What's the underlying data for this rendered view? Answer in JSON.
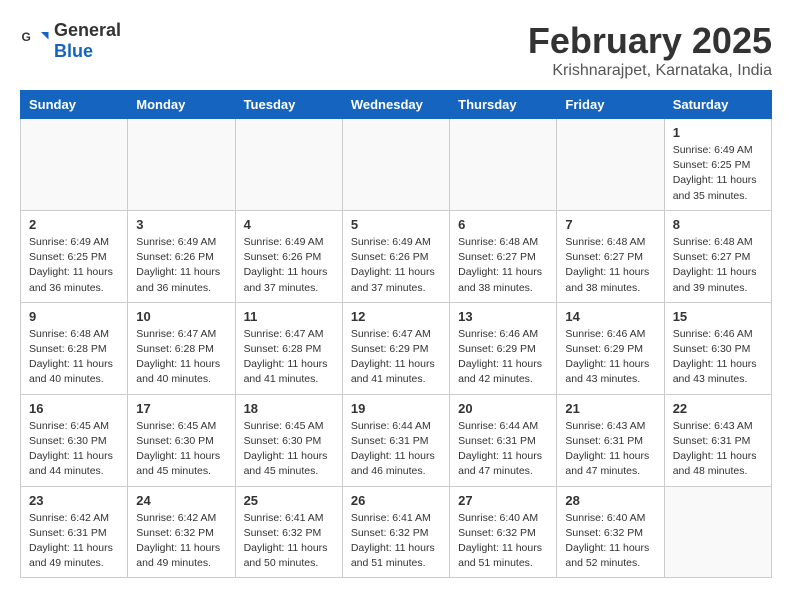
{
  "header": {
    "logo_general": "General",
    "logo_blue": "Blue",
    "title": "February 2025",
    "subtitle": "Krishnarajpet, Karnataka, India"
  },
  "days_of_week": [
    "Sunday",
    "Monday",
    "Tuesday",
    "Wednesday",
    "Thursday",
    "Friday",
    "Saturday"
  ],
  "weeks": [
    [
      {
        "day": "",
        "info": ""
      },
      {
        "day": "",
        "info": ""
      },
      {
        "day": "",
        "info": ""
      },
      {
        "day": "",
        "info": ""
      },
      {
        "day": "",
        "info": ""
      },
      {
        "day": "",
        "info": ""
      },
      {
        "day": "1",
        "info": "Sunrise: 6:49 AM\nSunset: 6:25 PM\nDaylight: 11 hours\nand 35 minutes."
      }
    ],
    [
      {
        "day": "2",
        "info": "Sunrise: 6:49 AM\nSunset: 6:25 PM\nDaylight: 11 hours\nand 36 minutes."
      },
      {
        "day": "3",
        "info": "Sunrise: 6:49 AM\nSunset: 6:26 PM\nDaylight: 11 hours\nand 36 minutes."
      },
      {
        "day": "4",
        "info": "Sunrise: 6:49 AM\nSunset: 6:26 PM\nDaylight: 11 hours\nand 37 minutes."
      },
      {
        "day": "5",
        "info": "Sunrise: 6:49 AM\nSunset: 6:26 PM\nDaylight: 11 hours\nand 37 minutes."
      },
      {
        "day": "6",
        "info": "Sunrise: 6:48 AM\nSunset: 6:27 PM\nDaylight: 11 hours\nand 38 minutes."
      },
      {
        "day": "7",
        "info": "Sunrise: 6:48 AM\nSunset: 6:27 PM\nDaylight: 11 hours\nand 38 minutes."
      },
      {
        "day": "8",
        "info": "Sunrise: 6:48 AM\nSunset: 6:27 PM\nDaylight: 11 hours\nand 39 minutes."
      }
    ],
    [
      {
        "day": "9",
        "info": "Sunrise: 6:48 AM\nSunset: 6:28 PM\nDaylight: 11 hours\nand 40 minutes."
      },
      {
        "day": "10",
        "info": "Sunrise: 6:47 AM\nSunset: 6:28 PM\nDaylight: 11 hours\nand 40 minutes."
      },
      {
        "day": "11",
        "info": "Sunrise: 6:47 AM\nSunset: 6:28 PM\nDaylight: 11 hours\nand 41 minutes."
      },
      {
        "day": "12",
        "info": "Sunrise: 6:47 AM\nSunset: 6:29 PM\nDaylight: 11 hours\nand 41 minutes."
      },
      {
        "day": "13",
        "info": "Sunrise: 6:46 AM\nSunset: 6:29 PM\nDaylight: 11 hours\nand 42 minutes."
      },
      {
        "day": "14",
        "info": "Sunrise: 6:46 AM\nSunset: 6:29 PM\nDaylight: 11 hours\nand 43 minutes."
      },
      {
        "day": "15",
        "info": "Sunrise: 6:46 AM\nSunset: 6:30 PM\nDaylight: 11 hours\nand 43 minutes."
      }
    ],
    [
      {
        "day": "16",
        "info": "Sunrise: 6:45 AM\nSunset: 6:30 PM\nDaylight: 11 hours\nand 44 minutes."
      },
      {
        "day": "17",
        "info": "Sunrise: 6:45 AM\nSunset: 6:30 PM\nDaylight: 11 hours\nand 45 minutes."
      },
      {
        "day": "18",
        "info": "Sunrise: 6:45 AM\nSunset: 6:30 PM\nDaylight: 11 hours\nand 45 minutes."
      },
      {
        "day": "19",
        "info": "Sunrise: 6:44 AM\nSunset: 6:31 PM\nDaylight: 11 hours\nand 46 minutes."
      },
      {
        "day": "20",
        "info": "Sunrise: 6:44 AM\nSunset: 6:31 PM\nDaylight: 11 hours\nand 47 minutes."
      },
      {
        "day": "21",
        "info": "Sunrise: 6:43 AM\nSunset: 6:31 PM\nDaylight: 11 hours\nand 47 minutes."
      },
      {
        "day": "22",
        "info": "Sunrise: 6:43 AM\nSunset: 6:31 PM\nDaylight: 11 hours\nand 48 minutes."
      }
    ],
    [
      {
        "day": "23",
        "info": "Sunrise: 6:42 AM\nSunset: 6:31 PM\nDaylight: 11 hours\nand 49 minutes."
      },
      {
        "day": "24",
        "info": "Sunrise: 6:42 AM\nSunset: 6:32 PM\nDaylight: 11 hours\nand 49 minutes."
      },
      {
        "day": "25",
        "info": "Sunrise: 6:41 AM\nSunset: 6:32 PM\nDaylight: 11 hours\nand 50 minutes."
      },
      {
        "day": "26",
        "info": "Sunrise: 6:41 AM\nSunset: 6:32 PM\nDaylight: 11 hours\nand 51 minutes."
      },
      {
        "day": "27",
        "info": "Sunrise: 6:40 AM\nSunset: 6:32 PM\nDaylight: 11 hours\nand 51 minutes."
      },
      {
        "day": "28",
        "info": "Sunrise: 6:40 AM\nSunset: 6:32 PM\nDaylight: 11 hours\nand 52 minutes."
      },
      {
        "day": "",
        "info": ""
      }
    ]
  ]
}
